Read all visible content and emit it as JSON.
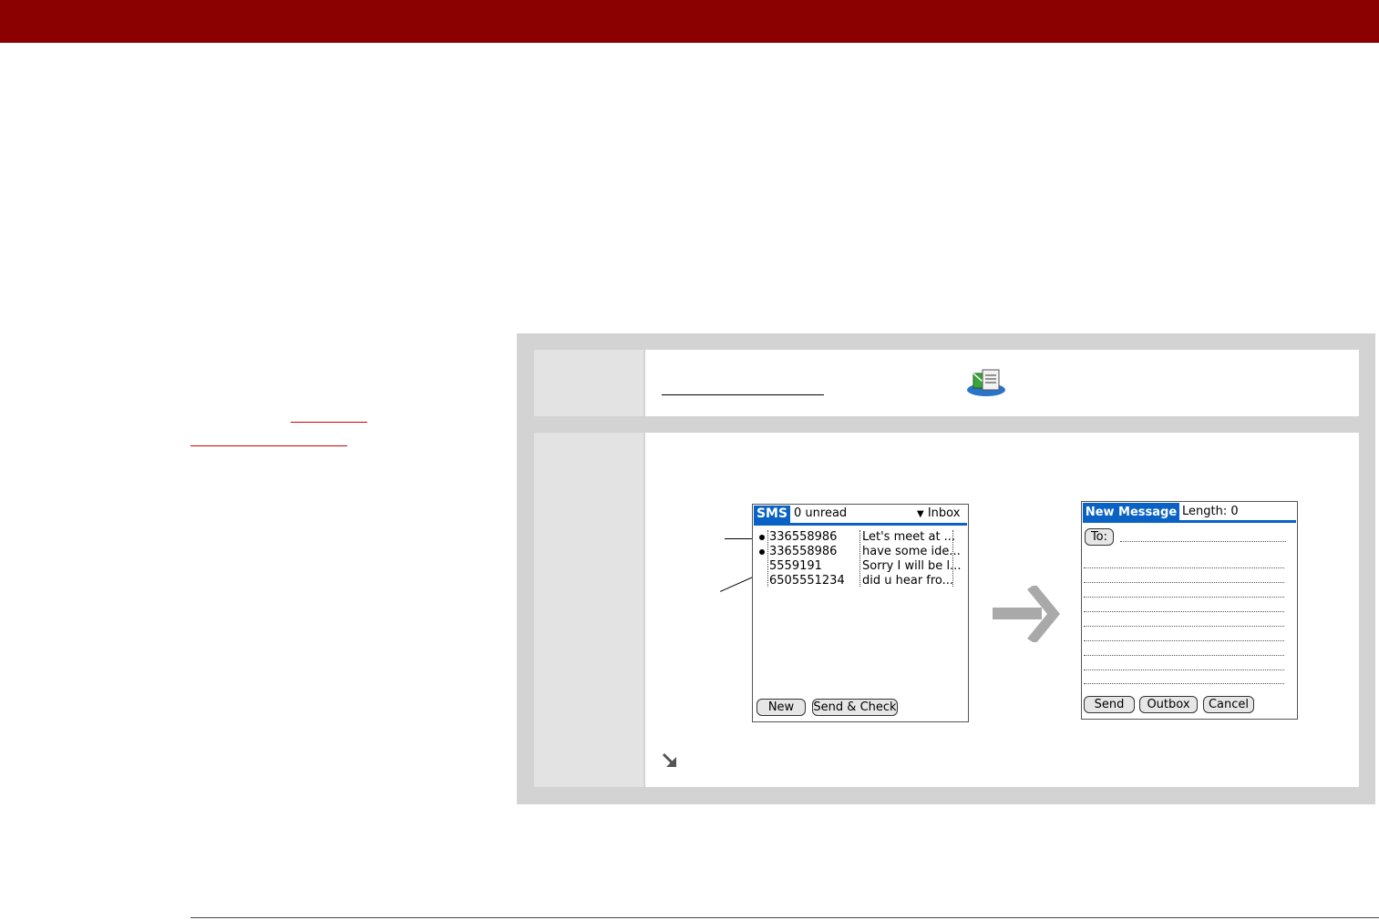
{
  "header": {
    "bar_color": "#8b0000"
  },
  "step1": {
    "icon": "sms-app-icon"
  },
  "sms_screen": {
    "tab": "SMS",
    "unread": "0 unread",
    "folder": "Inbox",
    "rows": [
      {
        "number": "336558986",
        "text": "Let's meet at ...",
        "unread": true
      },
      {
        "number": "336558986",
        "text": "have some ide...",
        "unread": true
      },
      {
        "number": "5559191",
        "text": "Sorry I will be l...",
        "unread": false
      },
      {
        "number": "6505551234",
        "text": "did u hear fro...",
        "unread": false
      }
    ],
    "buttons": {
      "new": "New",
      "send_check": "Send & Check"
    }
  },
  "new_message_screen": {
    "tab": "New Message",
    "length": "Length: 0",
    "to_button": "To:",
    "buttons": {
      "send": "Send",
      "outbox": "Outbox",
      "cancel": "Cancel"
    }
  },
  "icons": {
    "arrow": "right-arrow-icon",
    "continue": "continue-arrow-icon"
  },
  "colors": {
    "accent": "#0a63c4",
    "panel": "#d3d3d3"
  }
}
